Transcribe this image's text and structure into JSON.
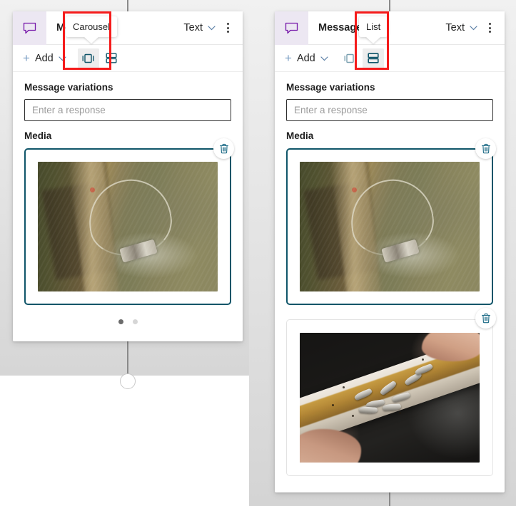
{
  "app": {
    "canvas_background": "#e6e6e6",
    "accent_teal": "#0f5569",
    "annotation_color": "#f51b1b",
    "node_icon_bg": "#ece7f2"
  },
  "nodes": [
    {
      "id": "left-node",
      "header": {
        "icon": "message-bubble-icon",
        "title": "Message",
        "format_dropdown": {
          "label": "Text",
          "chevron_icon": "chevron-down-icon"
        },
        "more_menu_icon": "more-vertical-icon"
      },
      "toolbar": {
        "add_label": "Add",
        "add_plus_icon": "plus-icon",
        "add_chevron_icon": "chevron-down-icon",
        "carousel_icon": "carousel-layout-icon",
        "list_icon": "list-layout-icon",
        "selected_layout": "carousel"
      },
      "tooltip": {
        "text": "Carousel",
        "points_to": "carousel-layout-icon"
      },
      "body": {
        "variations_label": "Message variations",
        "response_value": "",
        "response_placeholder": "Enter a response",
        "media_label": "Media",
        "media_cards": [
          {
            "selected": true,
            "delete_icon": "trash-icon",
            "image_alt": "aerial photo of a fishing boat with net on a muddy shoreline"
          }
        ],
        "carousel_dots": {
          "count": 2,
          "active_index": 0
        }
      }
    },
    {
      "id": "right-node",
      "header": {
        "icon": "message-bubble-icon",
        "title": "Message",
        "format_dropdown": {
          "label": "Text",
          "chevron_icon": "chevron-down-icon"
        },
        "more_menu_icon": "more-vertical-icon"
      },
      "toolbar": {
        "add_label": "Add",
        "add_plus_icon": "plus-icon",
        "add_chevron_icon": "chevron-down-icon",
        "carousel_icon": "carousel-layout-icon",
        "list_icon": "list-layout-icon",
        "selected_layout": "list"
      },
      "tooltip": {
        "text": "List",
        "points_to": "list-layout-icon"
      },
      "body": {
        "variations_label": "Message variations",
        "response_value": "",
        "response_placeholder": "Enter a response",
        "media_label": "Media",
        "media_cards": [
          {
            "selected": true,
            "delete_icon": "trash-icon",
            "image_alt": "aerial photo of a fishing boat with net on a muddy shoreline"
          },
          {
            "selected": false,
            "delete_icon": "trash-icon",
            "image_alt": "hands holding a white tray of small silver fish"
          }
        ]
      }
    }
  ]
}
